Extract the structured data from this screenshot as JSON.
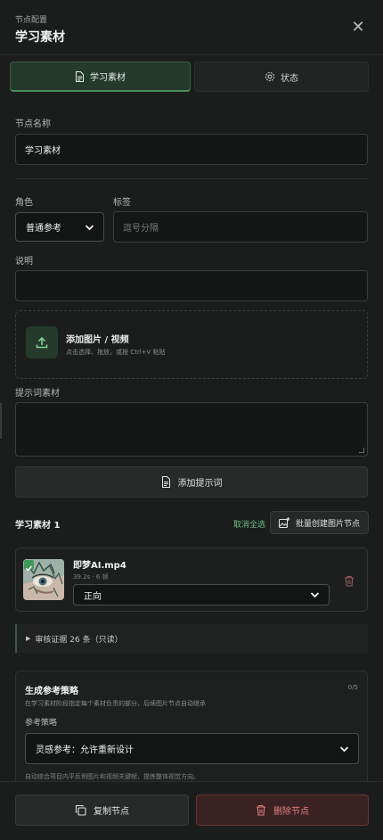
{
  "header": {
    "subtitle": "节点配置",
    "title": "学习素材",
    "close": "✕"
  },
  "tabs": [
    {
      "label": "学习素材",
      "active": true
    },
    {
      "label": "状态",
      "active": false
    }
  ],
  "node_name": {
    "label": "节点名称",
    "value": "学习素材"
  },
  "role": {
    "label": "角色",
    "value": "普通参考"
  },
  "tags": {
    "label": "标签",
    "placeholder": "逗号分隔"
  },
  "description": {
    "label": "说明",
    "value": ""
  },
  "upload": {
    "title": "添加图片 / 视频",
    "hint": "点击选择、拖放，或按 Ctrl+V 粘贴"
  },
  "prompt_material": {
    "label": "提示词素材",
    "value": ""
  },
  "add_prompt_button": "添加提示词",
  "materials": {
    "title": "学习素材 1",
    "deselect_all": "取消全选",
    "batch_create": "批量创建图片节点",
    "items": [
      {
        "name": "即梦AI.mp4",
        "meta": "39.2s · 6 帧",
        "direction": "正向",
        "checked": true
      }
    ]
  },
  "audit": {
    "label": "审核证据 26 条（只读）"
  },
  "strategy": {
    "title": "生成参考策略",
    "count": "0/5",
    "desc": "在学习素材阶段指定每个素材负责的部分，后续图片节点自动继承",
    "field_label": "参考策略",
    "value": "灵感参考：允许重新设计",
    "footnote": "自动综合项目内平反例图片和视频关键帧，提炼整体视觉方向。"
  },
  "footer": {
    "copy": "复制节点",
    "delete": "删除节点"
  },
  "colors": {
    "accent": "#4b8a5f",
    "danger": "#e08080",
    "bg": "#1b1d1c"
  }
}
